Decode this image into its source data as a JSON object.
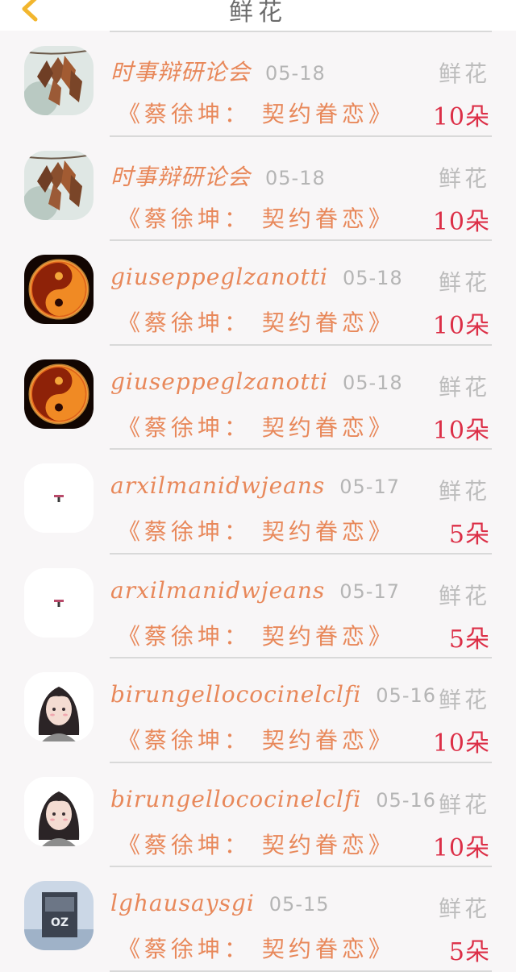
{
  "header": {
    "title": "鲜花",
    "back_icon": "chevron-left-icon",
    "accent": "#f2b62e"
  },
  "colors": {
    "name": "#e8885a",
    "date": "#b5b5b5",
    "label": "#bcbcbc",
    "amount": "#dc2f47"
  },
  "records": [
    {
      "avatar": "autumn-leaves",
      "name": "时事辩研论会",
      "date": "05-18",
      "label": "鲜花",
      "title": "《蔡徐坤： 契约眷恋》",
      "amount": "10朵"
    },
    {
      "avatar": "autumn-leaves",
      "name": "时事辩研论会",
      "date": "05-18",
      "label": "鲜花",
      "title": "《蔡徐坤： 契约眷恋》",
      "amount": "10朵"
    },
    {
      "avatar": "fire-yinyang",
      "name": "giuseppeglzanotti",
      "date": "05-18",
      "label": "鲜花",
      "title": "《蔡徐坤： 契约眷恋》",
      "amount": "10朵"
    },
    {
      "avatar": "fire-yinyang",
      "name": "giuseppeglzanotti",
      "date": "05-18",
      "label": "鲜花",
      "title": "《蔡徐坤： 契约眷恋》",
      "amount": "10朵"
    },
    {
      "avatar": "logo-t",
      "name": "arxilmanidwjeans",
      "date": "05-17",
      "label": "鲜花",
      "title": "《蔡徐坤： 契约眷恋》",
      "amount": "5朵"
    },
    {
      "avatar": "logo-t",
      "name": "arxilmanidwjeans",
      "date": "05-17",
      "label": "鲜花",
      "title": "《蔡徐坤： 契约眷恋》",
      "amount": "5朵"
    },
    {
      "avatar": "girl-portrait",
      "name": "birungellococinelclfi",
      "date": "05-16",
      "label": "鲜花",
      "title": "《蔡徐坤： 契约眷恋》",
      "amount": "10朵"
    },
    {
      "avatar": "girl-portrait",
      "name": "birungellococinelclfi",
      "date": "05-16",
      "label": "鲜花",
      "title": "《蔡徐坤： 契约眷恋》",
      "amount": "10朵"
    },
    {
      "avatar": "poster-photo",
      "name": "lghausaysgi",
      "date": "05-15",
      "label": "鲜花",
      "title": "《蔡徐坤： 契约眷恋》",
      "amount": "5朵"
    }
  ]
}
